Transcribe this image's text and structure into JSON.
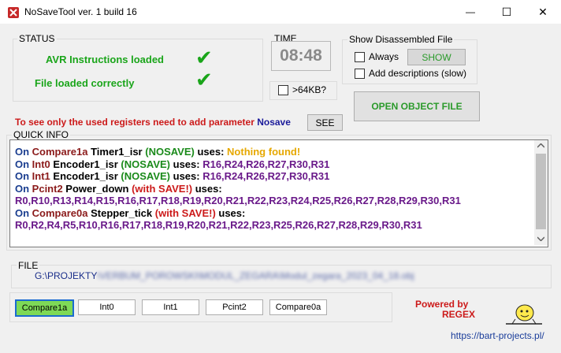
{
  "window": {
    "title": "NoSaveTool  ver. 1 build 16",
    "minimize_glyph": "—",
    "maximize_glyph": "☐",
    "close_glyph": "✕"
  },
  "status": {
    "legend": "STATUS",
    "line1": "AVR Instructions loaded",
    "line2": "File loaded correctly",
    "check": "✔"
  },
  "time": {
    "legend": "TIME",
    "value": "08:48",
    "over64_label": ">64KB?"
  },
  "disassembled": {
    "legend": "Show Disassembled File",
    "always_label": "Always",
    "show_button": "SHOW",
    "add_desc_label": "Add descriptions (slow)"
  },
  "open_button": "OPEN OBJECT FILE",
  "hint": {
    "text": "To see only the used registers need to add parameter ",
    "param": "Nosave",
    "see_button": "SEE"
  },
  "quick_info": {
    "legend": "QUICK INFO",
    "lines": [
      [
        {
          "t": "On ",
          "c": "#1a3d8f"
        },
        {
          "t": "Compare1a ",
          "c": "#8b1a1a"
        },
        {
          "t": "Timer1_isr ",
          "c": "#000000"
        },
        {
          "t": "(NOSAVE) ",
          "c": "#1a8a1a"
        },
        {
          "t": "uses: ",
          "c": "#000000"
        },
        {
          "t": "Nothing found!",
          "c": "#e6a800"
        }
      ],
      [
        {
          "t": "On ",
          "c": "#1a3d8f"
        },
        {
          "t": "Int0 ",
          "c": "#8b1a1a"
        },
        {
          "t": "Encoder1_isr ",
          "c": "#000000"
        },
        {
          "t": "(NOSAVE) ",
          "c": "#1a8a1a"
        },
        {
          "t": "uses: ",
          "c": "#000000"
        },
        {
          "t": "R16,R24,R26,R27,R30,R31",
          "c": "#6a1a8a"
        }
      ],
      [
        {
          "t": "On ",
          "c": "#1a3d8f"
        },
        {
          "t": "Int1 ",
          "c": "#8b1a1a"
        },
        {
          "t": "Encoder1_isr ",
          "c": "#000000"
        },
        {
          "t": "(NOSAVE) ",
          "c": "#1a8a1a"
        },
        {
          "t": "uses: ",
          "c": "#000000"
        },
        {
          "t": "R16,R24,R26,R27,R30,R31",
          "c": "#6a1a8a"
        }
      ],
      [
        {
          "t": "On ",
          "c": "#1a3d8f"
        },
        {
          "t": "Pcint2 ",
          "c": "#8b1a1a"
        },
        {
          "t": "Power_down ",
          "c": "#000000"
        },
        {
          "t": "(with SAVE!) ",
          "c": "#cc1a1a"
        },
        {
          "t": "uses:",
          "c": "#000000"
        }
      ],
      [
        {
          "t": "R0,R10,R13,R14,R15,R16,R17,R18,R19,R20,R21,R22,R23,R24,R25,R26,R27,R28,R29,R30,R31",
          "c": "#6a1a8a"
        }
      ],
      [
        {
          "t": "On ",
          "c": "#1a3d8f"
        },
        {
          "t": "Compare0a ",
          "c": "#8b1a1a"
        },
        {
          "t": "Stepper_tick ",
          "c": "#000000"
        },
        {
          "t": "(with SAVE!) ",
          "c": "#cc1a1a"
        },
        {
          "t": "uses:",
          "c": "#000000"
        }
      ],
      [
        {
          "t": "R0,R2,R4,R5,R10,R16,R17,R18,R19,R20,R21,R22,R23,R25,R26,R27,R28,R29,R30,R31",
          "c": "#6a1a8a"
        }
      ]
    ]
  },
  "file": {
    "legend": "FILE",
    "prefix": "G:\\PROJEKTY",
    "rest": "\\VERBUM_POROWSKI\\MODUL_ZEGARA\\Modul_zegara_2023_04_18.obj"
  },
  "vectors": [
    {
      "label": "Compare1a",
      "active": true
    },
    {
      "label": "Int0",
      "active": false
    },
    {
      "label": "Int1",
      "active": false
    },
    {
      "label": "Pcint2",
      "active": false
    },
    {
      "label": "Compare0a",
      "active": false
    }
  ],
  "powered": {
    "line1": "Powered by",
    "line2": "REGEX",
    "link": "https://bart-projects.pl/"
  }
}
